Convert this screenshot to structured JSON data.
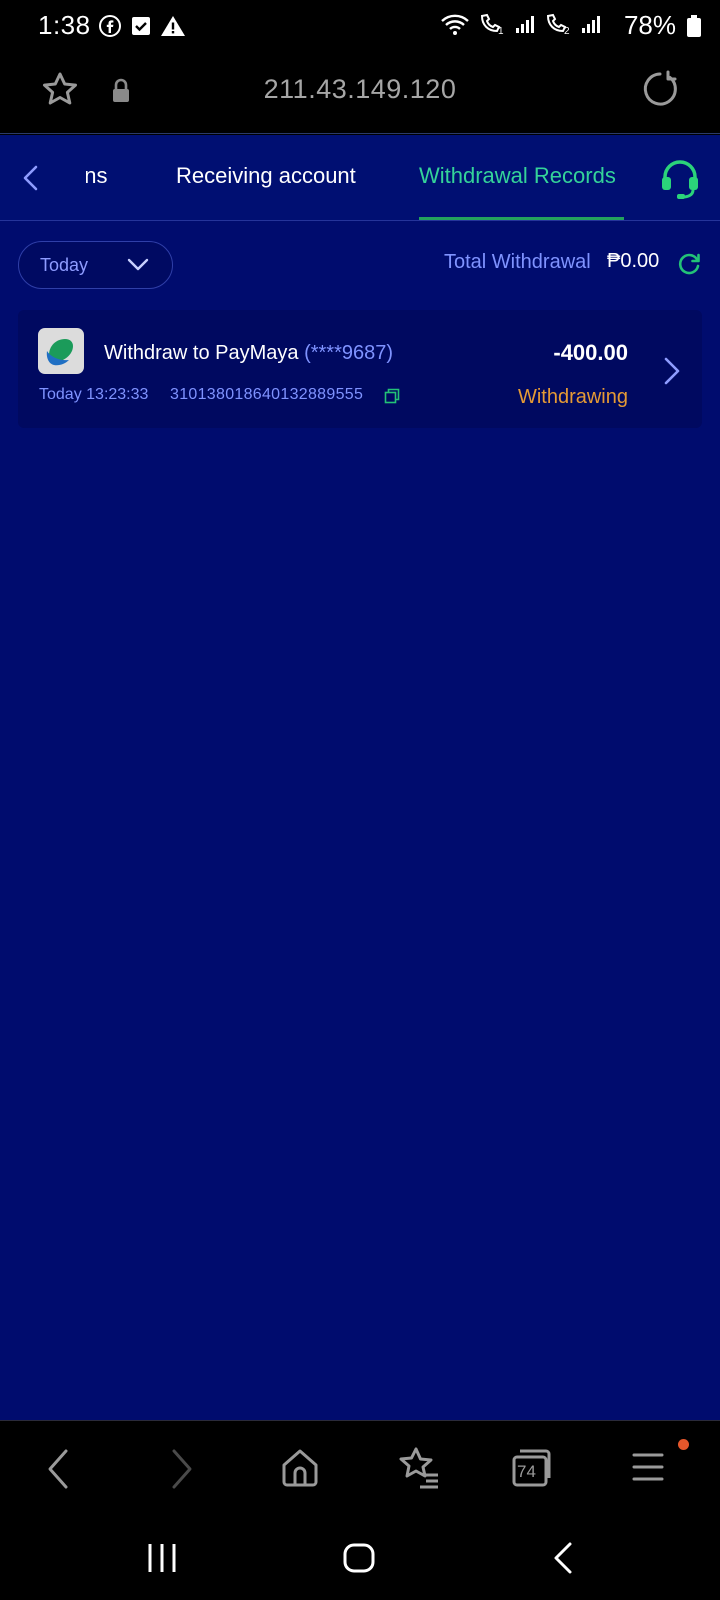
{
  "status_bar": {
    "time": "1:38",
    "battery": "78%",
    "left_icons": [
      "facebook-icon",
      "checkbox-notification-icon",
      "warning-icon"
    ],
    "right_icons": [
      "wifi-icon",
      "volte-sim1-icon",
      "signal-sim1-icon",
      "volte-sim2-icon",
      "signal-sim2-icon",
      "battery-icon"
    ]
  },
  "browser": {
    "url": "211.43.149.120",
    "tab_count": "74",
    "colors": {
      "menu_badge": "#e5572b"
    }
  },
  "tabs": {
    "partial_label": "ons",
    "receiving_label": "Receiving account",
    "withdrawal_label": "Withdrawal Records",
    "active": "Withdrawal Records"
  },
  "filter": {
    "selected": "Today"
  },
  "summary": {
    "total_label": "Total Withdrawal",
    "total_value": "₱0.00"
  },
  "records": [
    {
      "title": "Withdraw to PayMaya",
      "account": "(****9687)",
      "time": "Today 13:23:33",
      "transaction_id": "310138018640132889555",
      "amount": "-400.00",
      "status": "Withdrawing"
    }
  ],
  "colors": {
    "app_background": "#000c6e",
    "accent_green": "#34d399",
    "link_blue": "#7f93ff",
    "status_orange": "#e59a35"
  }
}
